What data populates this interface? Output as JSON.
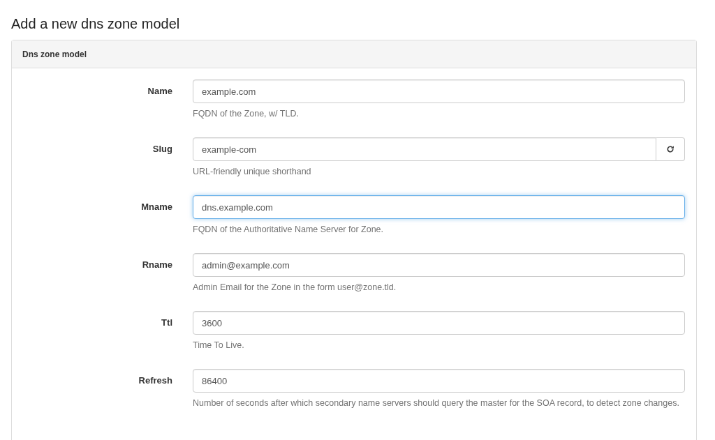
{
  "page_title": "Add a new dns zone model",
  "panel": {
    "heading": "Dns zone model",
    "fields": [
      {
        "label": "Name",
        "value": "example.com",
        "help": "FQDN of the Zone, w/ TLD.",
        "focused": false,
        "kind": "text"
      },
      {
        "label": "Slug",
        "value": "example-com",
        "help": "URL-friendly unique shorthand",
        "focused": false,
        "kind": "regenerate"
      },
      {
        "label": "Mname",
        "value": "dns.example.com",
        "help": "FQDN of the Authoritative Name Server for Zone.",
        "focused": true,
        "kind": "text"
      },
      {
        "label": "Rname",
        "value": "admin@example.com",
        "help": "Admin Email for the Zone in the form user@zone.tld.",
        "focused": false,
        "kind": "text"
      },
      {
        "label": "Ttl",
        "value": "3600",
        "help": "Time To Live.",
        "focused": false,
        "kind": "text"
      },
      {
        "label": "Refresh",
        "value": "86400",
        "help": "Number of seconds after which secondary name servers should query the master for the SOA record, to detect zone changes.",
        "focused": false,
        "kind": "text"
      }
    ]
  }
}
